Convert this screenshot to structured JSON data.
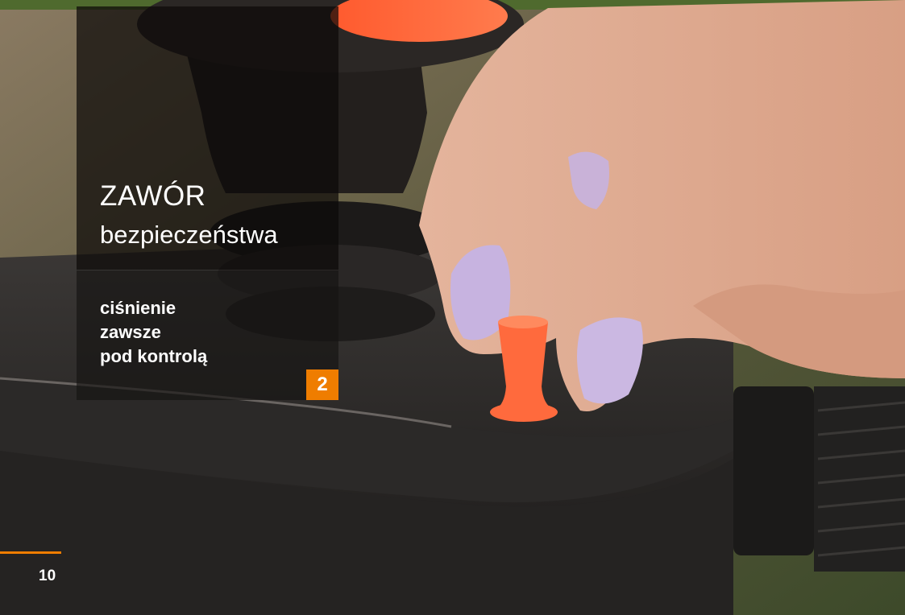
{
  "heading": {
    "title": "ZAWÓR",
    "subtitle": "bezpieczeństwa"
  },
  "tagline": {
    "lines": [
      "ciśnienie",
      "zawsze",
      "pod kontrolą"
    ]
  },
  "badge": {
    "number": "2"
  },
  "footer": {
    "page_number": "10"
  },
  "colors": {
    "accent": "#ef7d00",
    "valve_cap": "#ff6a3d"
  }
}
